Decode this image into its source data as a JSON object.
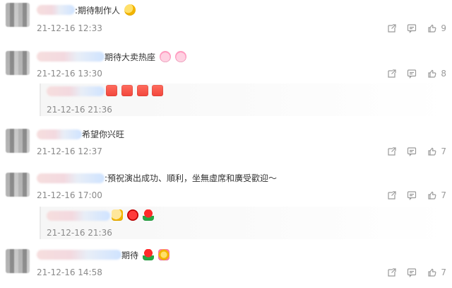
{
  "comments": [
    {
      "text": ":期待制作人",
      "emoji": [
        "smile-face-emoji"
      ],
      "time": "21-12-16 12:33",
      "like_count": "9"
    },
    {
      "text": "期待大卖热座",
      "emoji": [
        "pig-face-emoji",
        "pig-face-emoji"
      ],
      "time": "21-12-16 13:30",
      "like_count": "8",
      "reply": {
        "emoji": [
          "encourage-red-emoji",
          "encourage-red-emoji",
          "encourage-red-emoji",
          "encourage-red-emoji"
        ],
        "time": "21-12-16 21:36"
      }
    },
    {
      "text": "希望你兴旺",
      "emoji": [],
      "time": "21-12-16 12:37",
      "like_count": "7"
    },
    {
      "text": ":預祝演出成功、順利，坐無虛席和廣受歡迎～",
      "emoji": [],
      "time": "21-12-16 17:00",
      "like_count": "7",
      "reply": {
        "emoji": [
          "cheers-emoji",
          "flower-emoji",
          "rose-emoji"
        ],
        "time": "21-12-16 21:36"
      }
    },
    {
      "text": "期待",
      "emoji": [
        "rose-emoji",
        "group-emoji"
      ],
      "time": "21-12-16 14:58",
      "like_count": "7"
    }
  ],
  "icons": {
    "share": "share-icon",
    "comment": "comment-icon",
    "like": "like-icon"
  },
  "colors": {
    "time_gray": "#8a8a8a",
    "icon_gray": "#9a9a9a",
    "divider": "#e9e9e9"
  }
}
